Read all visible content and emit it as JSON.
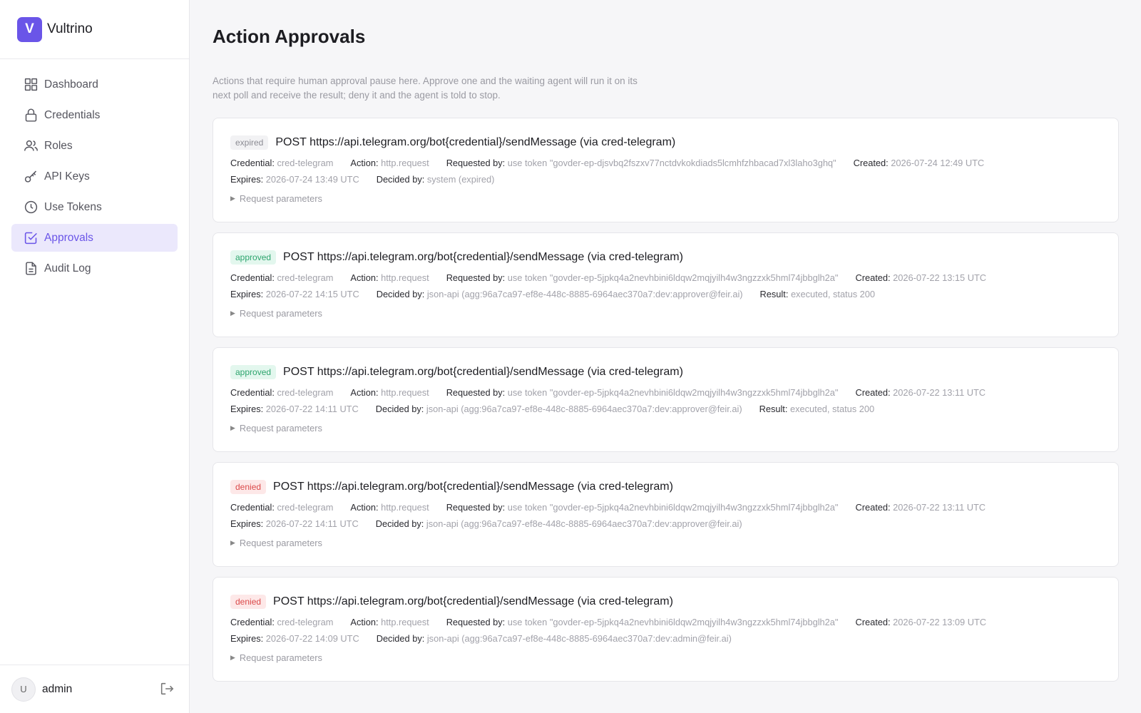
{
  "app": {
    "logo_letter": "V",
    "name": "Vultrino"
  },
  "nav": [
    {
      "label": "Dashboard",
      "icon": "dashboard-grid-icon",
      "active": false
    },
    {
      "label": "Credentials",
      "icon": "lock-icon",
      "active": false
    },
    {
      "label": "Roles",
      "icon": "users-icon",
      "active": false
    },
    {
      "label": "API Keys",
      "icon": "key-icon",
      "active": false
    },
    {
      "label": "Use Tokens",
      "icon": "clock-icon",
      "active": false
    },
    {
      "label": "Approvals",
      "icon": "check-square-icon",
      "active": true
    },
    {
      "label": "Audit Log",
      "icon": "document-icon",
      "active": false
    }
  ],
  "user": {
    "initial": "U",
    "name": "admin",
    "logout_icon": "logout-icon"
  },
  "page": {
    "title": "Action Approvals",
    "description": "Actions that require human approval pause here. Approve one and the waiting agent will run it on its next poll and receive the result; deny it and the agent is told to stop."
  },
  "labels": {
    "credential": "Credential:",
    "action": "Action:",
    "requested_by": "Requested by:",
    "created": "Created:",
    "expires": "Expires:",
    "decided_by": "Decided by:",
    "result": "Result:",
    "request_parameters": "Request parameters"
  },
  "colors": {
    "accent": "#6a55e8",
    "approved": "#2ea56e",
    "denied": "#db4a4a",
    "expired": "#8b8b93"
  },
  "approvals": [
    {
      "status": "expired",
      "title": "POST https://api.telegram.org/bot{credential}/sendMessage (via cred-telegram)",
      "credential": "cred-telegram",
      "action": "http.request",
      "requested_by": "use token \"govder-ep-djsvbq2fszxv77nctdvkokdiads5lcmhfzhbacad7xl3laho3ghq\"",
      "created": "2026-07-24 12:49 UTC",
      "expires": "2026-07-24 13:49 UTC",
      "decided_by": "system (expired)",
      "result": ""
    },
    {
      "status": "approved",
      "title": "POST https://api.telegram.org/bot{credential}/sendMessage (via cred-telegram)",
      "credential": "cred-telegram",
      "action": "http.request",
      "requested_by": "use token \"govder-ep-5jpkq4a2nevhbini6ldqw2mqjyilh4w3ngzzxk5hml74jbbglh2a\"",
      "created": "2026-07-22 13:15 UTC",
      "expires": "2026-07-22 14:15 UTC",
      "decided_by": "json-api (agg:96a7ca97-ef8e-448c-8885-6964aec370a7:dev:approver@feir.ai)",
      "result": "executed, status 200"
    },
    {
      "status": "approved",
      "title": "POST https://api.telegram.org/bot{credential}/sendMessage (via cred-telegram)",
      "credential": "cred-telegram",
      "action": "http.request",
      "requested_by": "use token \"govder-ep-5jpkq4a2nevhbini6ldqw2mqjyilh4w3ngzzxk5hml74jbbglh2a\"",
      "created": "2026-07-22 13:11 UTC",
      "expires": "2026-07-22 14:11 UTC",
      "decided_by": "json-api (agg:96a7ca97-ef8e-448c-8885-6964aec370a7:dev:approver@feir.ai)",
      "result": "executed, status 200"
    },
    {
      "status": "denied",
      "title": "POST https://api.telegram.org/bot{credential}/sendMessage (via cred-telegram)",
      "credential": "cred-telegram",
      "action": "http.request",
      "requested_by": "use token \"govder-ep-5jpkq4a2nevhbini6ldqw2mqjyilh4w3ngzzxk5hml74jbbglh2a\"",
      "created": "2026-07-22 13:11 UTC",
      "expires": "2026-07-22 14:11 UTC",
      "decided_by": "json-api (agg:96a7ca97-ef8e-448c-8885-6964aec370a7:dev:approver@feir.ai)",
      "result": ""
    },
    {
      "status": "denied",
      "title": "POST https://api.telegram.org/bot{credential}/sendMessage (via cred-telegram)",
      "credential": "cred-telegram",
      "action": "http.request",
      "requested_by": "use token \"govder-ep-5jpkq4a2nevhbini6ldqw2mqjyilh4w3ngzzxk5hml74jbbglh2a\"",
      "created": "2026-07-22 13:09 UTC",
      "expires": "2026-07-22 14:09 UTC",
      "decided_by": "json-api (agg:96a7ca97-ef8e-448c-8885-6964aec370a7:dev:admin@feir.ai)",
      "result": ""
    }
  ]
}
